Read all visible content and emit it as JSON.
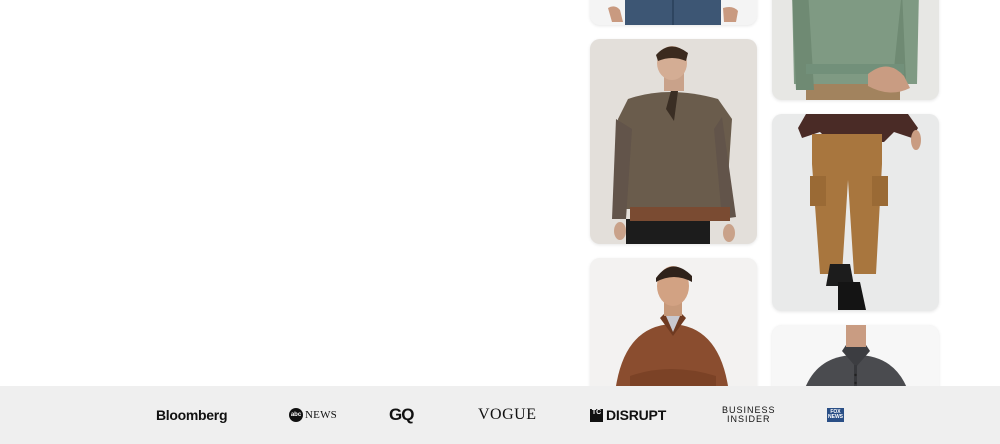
{
  "products": [
    {
      "name": "Jeans with hands",
      "image": "jeans-hands-image"
    },
    {
      "name": "Green knit sweater",
      "image": "green-sweater-image"
    },
    {
      "name": "Brown quarter-zip pullover",
      "image": "brown-quarter-zip-image"
    },
    {
      "name": "Tan cargo joggers",
      "image": "tan-cargo-joggers-image"
    },
    {
      "name": "Rust quarter-zip",
      "image": "rust-quarter-zip-image"
    },
    {
      "name": "Charcoal polo",
      "image": "charcoal-polo-image"
    }
  ],
  "press_logos": {
    "bloomberg": "Bloomberg",
    "abc_badge": "abc",
    "abc_news": "NEWS",
    "gq": "GQ",
    "vogue": "VOGUE",
    "tc_badge": "TC",
    "disrupt": "DISRUPT",
    "bi_line1": "BUSINESS",
    "bi_line2": "INSIDER",
    "fox_line1": "FOX",
    "fox_line2": "NEWS"
  },
  "colors": {
    "press_bar": "#efefef",
    "fox_blue": "#2a4f86"
  }
}
